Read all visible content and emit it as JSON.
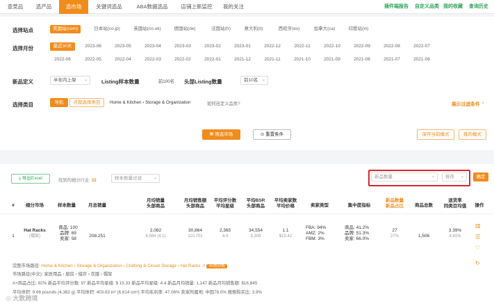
{
  "nav": {
    "tabs": [
      "查竞品",
      "选产品",
      "选市场",
      "关键词选品",
      "ABA数据选品",
      "店铺上新监控",
      "我的关注"
    ],
    "active_tab": "选市场",
    "right_links": [
      "插件端报告",
      "自定义品类",
      "我的收藏",
      "查询历史"
    ]
  },
  "filters": {
    "site_label": "选择站点",
    "sites": [
      "美国站(com)",
      "日本站(co.jp)",
      "英国站(co.uk)",
      "德国站(de)",
      "法国站(fr)",
      "意大利(it)",
      "西班牙(es)",
      "加拿大(ca)",
      "印度站(in)"
    ],
    "month_label": "选择月份",
    "months_row1": [
      "最近30天",
      "2023-06",
      "2023-05",
      "2023-04",
      "2023-03",
      "2023-02",
      "2023-01",
      "2022-12",
      "2022-11",
      "2022-10",
      "2022-09",
      "2022-08",
      "2022-07"
    ],
    "months_row2": [
      "2022-06",
      "2022-05",
      "2022-04",
      "2022-03",
      "2022-02",
      "2022-01",
      "2021-12",
      "2021-11",
      "2021-10",
      "2021-09",
      "2021-08",
      "2021-07",
      "2021-06"
    ],
    "new_def_label": "新品定义",
    "new_def_value": "半年内上架",
    "listing_sample_label": "Listing样本数量",
    "listing_sample_value": "前100名",
    "head_listing_label": "头部Listing数量",
    "head_listing_value": "前10名",
    "category_label": "选择类目",
    "nav_btn": "导航",
    "click_select": "点我选择类目",
    "category_path": "Home & Kitchen › Storage & Organization",
    "custom_category_q": "如何自定义品类?",
    "expand_filters": "展示过滤条件",
    "filter_btn": "筛选市场",
    "reset_btn": "重置条件",
    "save_mode_btn": "保存当前模式",
    "my_mode_btn": "我的模式"
  },
  "results": {
    "export_btn": "导出Excel",
    "found_text": "找到的细分行业:",
    "found_count": "32",
    "sample_filter_placeholder": "样本数量过滤",
    "sort_field": "新品数量",
    "sort_order": "排序",
    "confirm_btn": "确定",
    "headers": [
      {
        "l1": "#",
        "l2": ""
      },
      {
        "l1": "细分市场",
        "l2": ""
      },
      {
        "l1": "样本数量",
        "l2": ""
      },
      {
        "l1": "月总销量",
        "l2": ""
      },
      {
        "l1": "月均销量",
        "l2": "头部商品"
      },
      {
        "l1": "月均销售额",
        "l2": "头部商品"
      },
      {
        "l1": "平均评分数",
        "l2": "平均星级"
      },
      {
        "l1": "平均BSR",
        "l2": "头部商品"
      },
      {
        "l1": "平均卖家数",
        "l2": "平均价格"
      },
      {
        "l1": "卖家类型",
        "l2": ""
      },
      {
        "l1": "集中度指标",
        "l2": ""
      },
      {
        "l1": "新品数量",
        "l2": "新品占比"
      },
      {
        "l1": "商品总数",
        "l2": ""
      },
      {
        "l1": "退货率",
        "l2": "同类目均值"
      },
      {
        "l1": "操作",
        "l2": ""
      }
    ],
    "row": {
      "index": "1",
      "market": "Hat Racks",
      "market_sub": "(帽架)",
      "sample": [
        "商品: 100",
        "品牌: 69",
        "卖家: 58"
      ],
      "monthly_total": "208,251",
      "avg_sales": "2,082",
      "avg_sales_sub": "8,584 (4.1)",
      "avg_revenue": "30,864",
      "avg_revenue_sub": "110,701",
      "avg_reviews": "2,365",
      "avg_rating": "4.4",
      "avg_bsr": "34,554",
      "avg_bsr_sub": "3,309",
      "avg_sellers": "1.1",
      "avg_price": "$15.42",
      "seller_type": [
        "FBA: 94%",
        "AMZ: 2%",
        "FBM: 3%"
      ],
      "concentration": [
        "商品: 41.2%",
        "品牌: 51.3%",
        "卖家: 66.0%"
      ],
      "new_count": "27",
      "new_ratio": "27%",
      "total_products": "1,506",
      "return_rate": "3.39%",
      "return_avg": "4.81%"
    },
    "detail": {
      "path_label": "完整市场路径:",
      "path": "Home & Kitchen › Storage & Organization › Clothing & Closet Storage › Hat Racks",
      "analysis_btn": "市场分析",
      "cn_path": "市场路径(中文): 家居用品 › 厨房 › 储存 › 衣服 › 帽架",
      "line3": "A+商品占比: 92%   新品平均评分数: 97   新品平均星级: $ 15.33   新品平均星级: 4.4   新品月均销量: 1,147   新品月均销售额: $16,845",
      "line4": "平均体积: 9.66 pounds (4,382 g)   平均体积: 403.63 in³ (6,614 cm³)   平均毛利率: 47.06%   卖家所属地: 中国78.0%   搜索购买比: 3.9%"
    },
    "watermark": "大数跨境"
  }
}
